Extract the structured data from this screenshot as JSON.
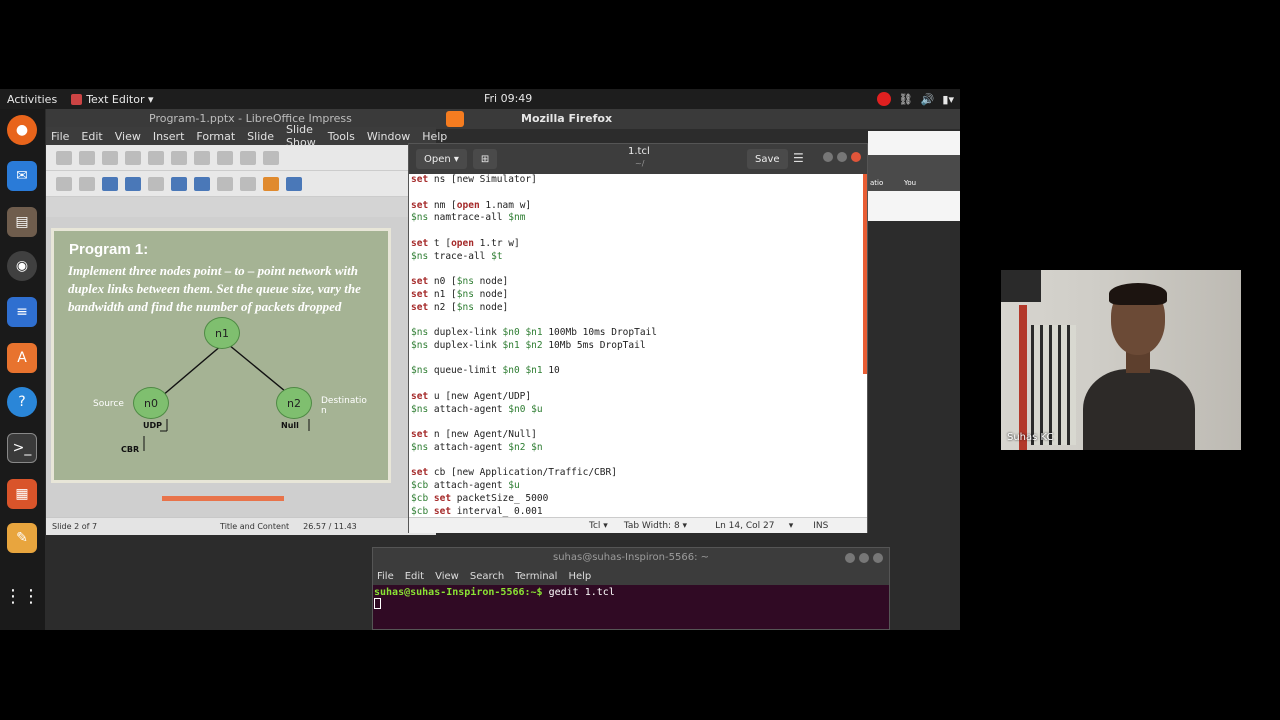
{
  "topbar": {
    "activities": "Activities",
    "app_menu": "Text Editor ▾",
    "clock": "Fri 09:49"
  },
  "impress": {
    "title": "Program-1.pptx - LibreOffice Impress",
    "menu": [
      "File",
      "Edit",
      "View",
      "Insert",
      "Format",
      "Slide",
      "Slide Show",
      "Tools",
      "Window",
      "Help"
    ],
    "slide": {
      "title": "Program 1:",
      "body": "Implement three nodes point – to – point network with duplex links between them. Set the queue size, vary the bandwidth and find the number of packets dropped",
      "nodes": [
        "n1",
        "n0",
        "n2"
      ],
      "labels": {
        "source": "Source",
        "destination": "Destinatio n",
        "udp": "UDP",
        "cbr": "CBR",
        "null": "Null"
      }
    },
    "status": {
      "slide": "Slide 2 of 7",
      "layout": "Title and Content",
      "coords": "26.57 / 11.43"
    }
  },
  "firefox": {
    "name": "Mozilla Firefox",
    "tab_labels": [
      "atio",
      "You"
    ]
  },
  "gedit": {
    "open_label": "Open",
    "save_label": "Save",
    "filename": "1.tcl",
    "path": "~/",
    "status": {
      "lang": "Tcl",
      "tab_width": "Tab Width: 8",
      "position": "Ln 14, Col 27",
      "mode": "INS"
    }
  },
  "terminal": {
    "title": "suhas@suhas-Inspiron-5566: ~",
    "menu": [
      "File",
      "Edit",
      "View",
      "Search",
      "Terminal",
      "Help"
    ],
    "prompt": "suhas@suhas-Inspiron-5566:~$",
    "command": " gedit 1.tcl"
  },
  "webcam": {
    "name": "Suhas KC"
  }
}
